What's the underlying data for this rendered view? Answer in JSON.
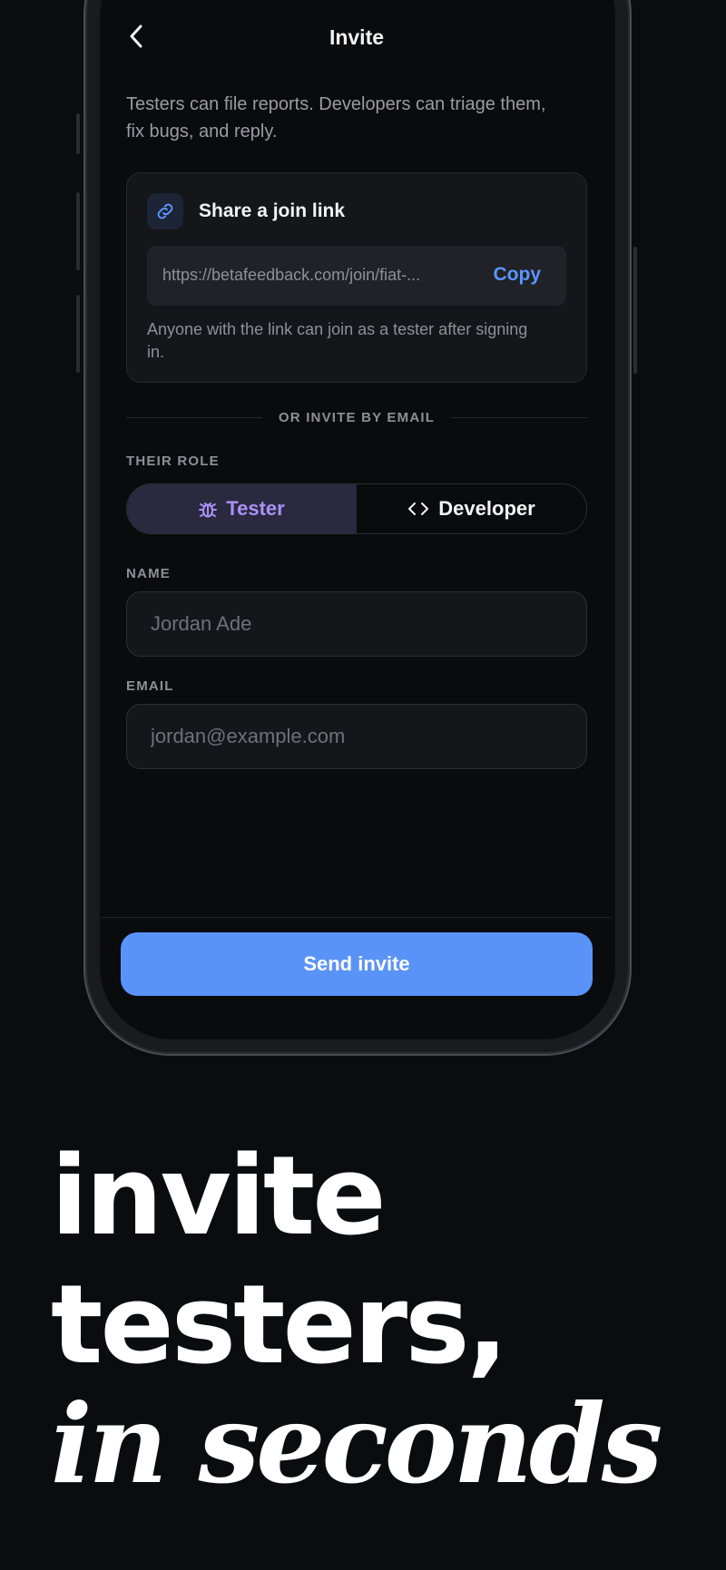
{
  "header": {
    "title": "Invite"
  },
  "intro": "Testers can file reports. Developers can triage them, fix bugs, and reply.",
  "share": {
    "title": "Share a join link",
    "url": "https://betafeedback.com/join/fiat-...",
    "copy_label": "Copy",
    "note": "Anyone with the link can join as a tester after signing in."
  },
  "divider": "OR INVITE BY EMAIL",
  "role": {
    "label": "THEIR ROLE",
    "options": [
      {
        "label": "Tester",
        "icon": "bug-icon",
        "selected": true
      },
      {
        "label": "Developer",
        "icon": "code-icon",
        "selected": false
      }
    ]
  },
  "name_field": {
    "label": "NAME",
    "placeholder": "Jordan Ade"
  },
  "email_field": {
    "label": "EMAIL",
    "placeholder": "jordan@example.com"
  },
  "send_label": "Send invite",
  "headline": {
    "line1": "invite",
    "line2": "testers,",
    "line3": "in seconds"
  },
  "colors": {
    "accent": "#5a93f8",
    "tester_accent": "#a991f5",
    "background": "#0b0c0f"
  }
}
